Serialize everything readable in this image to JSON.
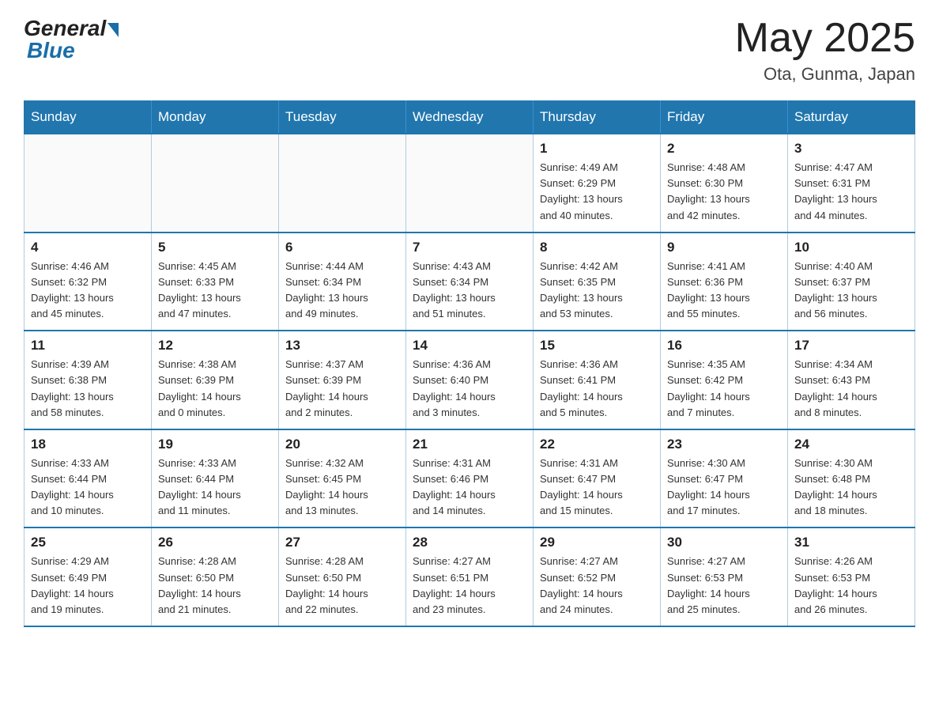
{
  "header": {
    "logo_general": "General",
    "logo_blue": "Blue",
    "month_year": "May 2025",
    "location": "Ota, Gunma, Japan"
  },
  "weekdays": [
    "Sunday",
    "Monday",
    "Tuesday",
    "Wednesday",
    "Thursday",
    "Friday",
    "Saturday"
  ],
  "weeks": [
    {
      "days": [
        {
          "num": "",
          "info": ""
        },
        {
          "num": "",
          "info": ""
        },
        {
          "num": "",
          "info": ""
        },
        {
          "num": "",
          "info": ""
        },
        {
          "num": "1",
          "info": "Sunrise: 4:49 AM\nSunset: 6:29 PM\nDaylight: 13 hours\nand 40 minutes."
        },
        {
          "num": "2",
          "info": "Sunrise: 4:48 AM\nSunset: 6:30 PM\nDaylight: 13 hours\nand 42 minutes."
        },
        {
          "num": "3",
          "info": "Sunrise: 4:47 AM\nSunset: 6:31 PM\nDaylight: 13 hours\nand 44 minutes."
        }
      ]
    },
    {
      "days": [
        {
          "num": "4",
          "info": "Sunrise: 4:46 AM\nSunset: 6:32 PM\nDaylight: 13 hours\nand 45 minutes."
        },
        {
          "num": "5",
          "info": "Sunrise: 4:45 AM\nSunset: 6:33 PM\nDaylight: 13 hours\nand 47 minutes."
        },
        {
          "num": "6",
          "info": "Sunrise: 4:44 AM\nSunset: 6:34 PM\nDaylight: 13 hours\nand 49 minutes."
        },
        {
          "num": "7",
          "info": "Sunrise: 4:43 AM\nSunset: 6:34 PM\nDaylight: 13 hours\nand 51 minutes."
        },
        {
          "num": "8",
          "info": "Sunrise: 4:42 AM\nSunset: 6:35 PM\nDaylight: 13 hours\nand 53 minutes."
        },
        {
          "num": "9",
          "info": "Sunrise: 4:41 AM\nSunset: 6:36 PM\nDaylight: 13 hours\nand 55 minutes."
        },
        {
          "num": "10",
          "info": "Sunrise: 4:40 AM\nSunset: 6:37 PM\nDaylight: 13 hours\nand 56 minutes."
        }
      ]
    },
    {
      "days": [
        {
          "num": "11",
          "info": "Sunrise: 4:39 AM\nSunset: 6:38 PM\nDaylight: 13 hours\nand 58 minutes."
        },
        {
          "num": "12",
          "info": "Sunrise: 4:38 AM\nSunset: 6:39 PM\nDaylight: 14 hours\nand 0 minutes."
        },
        {
          "num": "13",
          "info": "Sunrise: 4:37 AM\nSunset: 6:39 PM\nDaylight: 14 hours\nand 2 minutes."
        },
        {
          "num": "14",
          "info": "Sunrise: 4:36 AM\nSunset: 6:40 PM\nDaylight: 14 hours\nand 3 minutes."
        },
        {
          "num": "15",
          "info": "Sunrise: 4:36 AM\nSunset: 6:41 PM\nDaylight: 14 hours\nand 5 minutes."
        },
        {
          "num": "16",
          "info": "Sunrise: 4:35 AM\nSunset: 6:42 PM\nDaylight: 14 hours\nand 7 minutes."
        },
        {
          "num": "17",
          "info": "Sunrise: 4:34 AM\nSunset: 6:43 PM\nDaylight: 14 hours\nand 8 minutes."
        }
      ]
    },
    {
      "days": [
        {
          "num": "18",
          "info": "Sunrise: 4:33 AM\nSunset: 6:44 PM\nDaylight: 14 hours\nand 10 minutes."
        },
        {
          "num": "19",
          "info": "Sunrise: 4:33 AM\nSunset: 6:44 PM\nDaylight: 14 hours\nand 11 minutes."
        },
        {
          "num": "20",
          "info": "Sunrise: 4:32 AM\nSunset: 6:45 PM\nDaylight: 14 hours\nand 13 minutes."
        },
        {
          "num": "21",
          "info": "Sunrise: 4:31 AM\nSunset: 6:46 PM\nDaylight: 14 hours\nand 14 minutes."
        },
        {
          "num": "22",
          "info": "Sunrise: 4:31 AM\nSunset: 6:47 PM\nDaylight: 14 hours\nand 15 minutes."
        },
        {
          "num": "23",
          "info": "Sunrise: 4:30 AM\nSunset: 6:47 PM\nDaylight: 14 hours\nand 17 minutes."
        },
        {
          "num": "24",
          "info": "Sunrise: 4:30 AM\nSunset: 6:48 PM\nDaylight: 14 hours\nand 18 minutes."
        }
      ]
    },
    {
      "days": [
        {
          "num": "25",
          "info": "Sunrise: 4:29 AM\nSunset: 6:49 PM\nDaylight: 14 hours\nand 19 minutes."
        },
        {
          "num": "26",
          "info": "Sunrise: 4:28 AM\nSunset: 6:50 PM\nDaylight: 14 hours\nand 21 minutes."
        },
        {
          "num": "27",
          "info": "Sunrise: 4:28 AM\nSunset: 6:50 PM\nDaylight: 14 hours\nand 22 minutes."
        },
        {
          "num": "28",
          "info": "Sunrise: 4:27 AM\nSunset: 6:51 PM\nDaylight: 14 hours\nand 23 minutes."
        },
        {
          "num": "29",
          "info": "Sunrise: 4:27 AM\nSunset: 6:52 PM\nDaylight: 14 hours\nand 24 minutes."
        },
        {
          "num": "30",
          "info": "Sunrise: 4:27 AM\nSunset: 6:53 PM\nDaylight: 14 hours\nand 25 minutes."
        },
        {
          "num": "31",
          "info": "Sunrise: 4:26 AM\nSunset: 6:53 PM\nDaylight: 14 hours\nand 26 minutes."
        }
      ]
    }
  ]
}
